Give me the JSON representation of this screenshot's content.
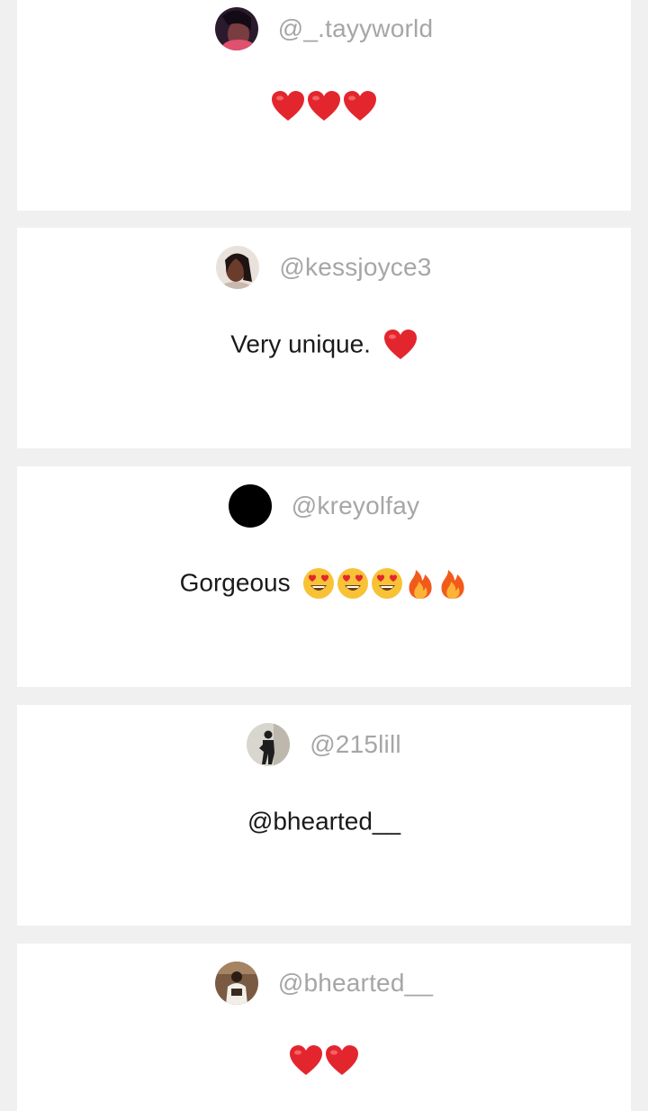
{
  "comments": [
    {
      "username": "@_.tayyworld",
      "text": "",
      "emojis": [
        "heart",
        "heart",
        "heart"
      ],
      "avatar": "photo-dark"
    },
    {
      "username": "@kessjoyce3",
      "text": "Very unique.",
      "emojis": [
        "heart"
      ],
      "avatar": "photo-light"
    },
    {
      "username": "@kreyolfay",
      "text": "Gorgeous",
      "emojis": [
        "heart-eyes",
        "heart-eyes",
        "heart-eyes",
        "fire",
        "fire"
      ],
      "avatar": "black"
    },
    {
      "username": "@215lill",
      "text": "@bhearted__",
      "emojis": [],
      "avatar": "photo-figure"
    },
    {
      "username": "@bhearted__",
      "text": "",
      "emojis": [
        "heart",
        "heart"
      ],
      "avatar": "photo-brown"
    }
  ],
  "colors": {
    "background": "#f0f0f0",
    "card": "#ffffff",
    "username": "#a6a6a6",
    "text": "#1a1a1a",
    "heart": "#e3262e"
  }
}
